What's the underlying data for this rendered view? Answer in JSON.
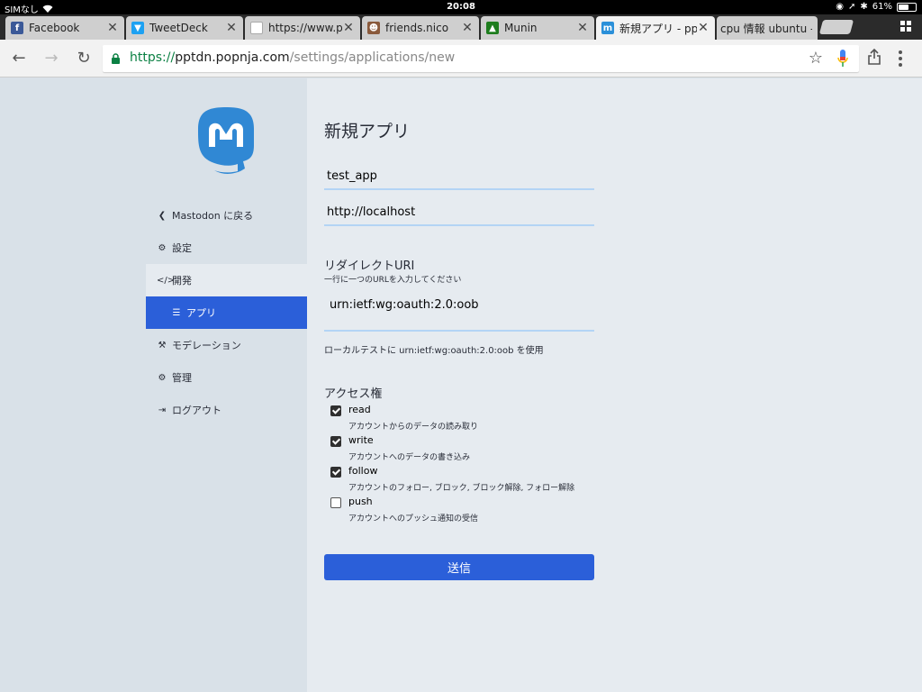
{
  "status_bar": {
    "carrier": "SIMなし",
    "time": "20:08",
    "battery": "61%",
    "battery_level": 0.61
  },
  "tabs": [
    {
      "title": "Facebook",
      "icon": "facebook-icon",
      "color": "#3b5998",
      "glyph": "f"
    },
    {
      "title": "TweetDeck",
      "icon": "tweetdeck-icon",
      "color": "#1da1f2",
      "glyph": "▼"
    },
    {
      "title": "https://www.pptd",
      "icon": "page-icon",
      "color": "#ffffff",
      "glyph": ""
    },
    {
      "title": "friends.nico",
      "icon": "friends-nico-icon",
      "color": "#8a5a3c",
      "glyph": "☻"
    },
    {
      "title": "Munin",
      "icon": "munin-icon",
      "color": "#1e7d1e",
      "glyph": "▲"
    },
    {
      "title": "新規アプリ - pptd",
      "icon": "mastodon-tab-icon",
      "color": "#2b90d9",
      "glyph": "m"
    },
    {
      "title": "cpu 情報 ubuntu -",
      "icon": "",
      "color": "",
      "glyph": ""
    }
  ],
  "toolbar": {
    "url_scheme": "https://",
    "url_host": "pptdn.popnja.com",
    "url_path": "/settings/applications/new"
  },
  "sidebar": {
    "back_label": "Mastodon に戻る",
    "settings_label": "設定",
    "development_label": "開発",
    "apps_label": "アプリ",
    "moderation_label": "モデレーション",
    "admin_label": "管理",
    "logout_label": "ログアウト"
  },
  "form": {
    "title": "新規アプリ",
    "name_value": "test_app",
    "website_value": "http://localhost",
    "redirect_label": "リダイレクトURI",
    "redirect_hint": "一行に一つのURLを入力してください",
    "redirect_value": "urn:ietf:wg:oauth:2.0:oob",
    "local_test_hint": "ローカルテストに urn:ietf:wg:oauth:2.0:oob を使用",
    "scopes_label": "アクセス権",
    "scopes": [
      {
        "name": "read",
        "desc": "アカウントからのデータの読み取り",
        "checked": true
      },
      {
        "name": "write",
        "desc": "アカウントへのデータの書き込み",
        "checked": true
      },
      {
        "name": "follow",
        "desc": "アカウントのフォロー, ブロック, ブロック解除, フォロー解除",
        "checked": true
      },
      {
        "name": "push",
        "desc": "アカウントへのプッシュ通知の受信",
        "checked": false
      }
    ],
    "submit_label": "送信"
  },
  "colors": {
    "accent": "#2b5fd9",
    "sidebar_bg": "#d9e1e8",
    "main_bg": "#e6ebf0",
    "mastodon_logo": "#3088d4"
  }
}
